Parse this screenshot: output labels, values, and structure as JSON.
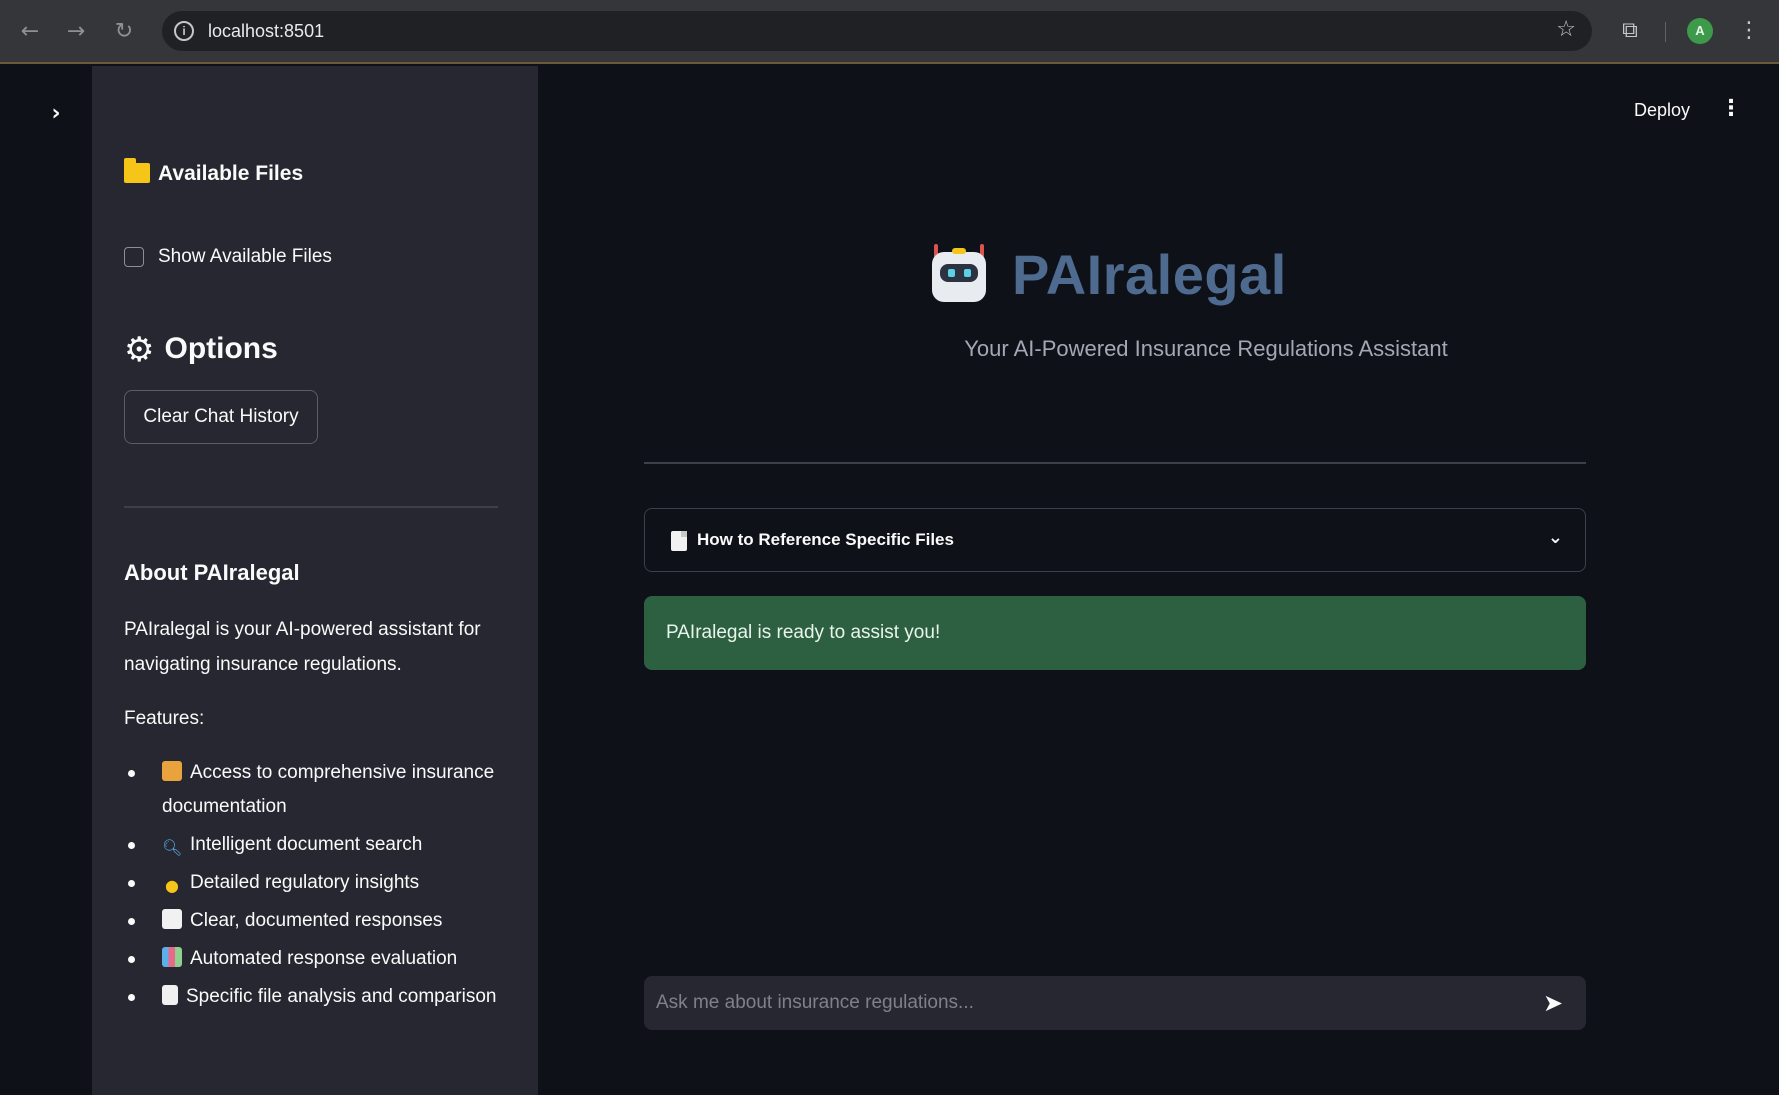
{
  "browser": {
    "url": "localhost:8501",
    "back_icon": "arrow-left-icon",
    "forward_icon": "arrow-right-icon",
    "reload_icon": "reload-icon",
    "profile_initial": "A"
  },
  "header": {
    "deploy_label": "Deploy"
  },
  "sidebar": {
    "files_heading": "Available Files",
    "show_files_label": "Show Available Files",
    "show_files_checked": false,
    "options_heading": "Options",
    "clear_button_label": "Clear Chat History",
    "about_heading": "About PAIralegal",
    "about_text": "PAIralegal is your AI-powered assistant for navigating insurance regulations.",
    "features_label": "Features:",
    "features": [
      {
        "icon": "books-icon",
        "text": "Access to comprehensive insurance documentation"
      },
      {
        "icon": "magnifier-icon",
        "text": "Intelligent document search"
      },
      {
        "icon": "lightbulb-icon",
        "text": "Detailed regulatory insights"
      },
      {
        "icon": "memo-icon",
        "text": "Clear, documented responses"
      },
      {
        "icon": "bar-chart-icon",
        "text": "Automated response evaluation"
      },
      {
        "icon": "page-icon",
        "text": "Specific file analysis and comparison"
      }
    ]
  },
  "main": {
    "title": "PAIralegal",
    "subtitle": "Your AI-Powered Insurance Regulations Assistant",
    "expander_label": "How to Reference Specific Files",
    "status_message": "PAIralegal is ready to assist you!",
    "chat_placeholder": "Ask me about insurance regulations..."
  },
  "colors": {
    "title": "#4f6a8f",
    "success_bg": "#2d5f41",
    "sidebar_bg": "#262730",
    "main_bg": "#0e1117"
  }
}
